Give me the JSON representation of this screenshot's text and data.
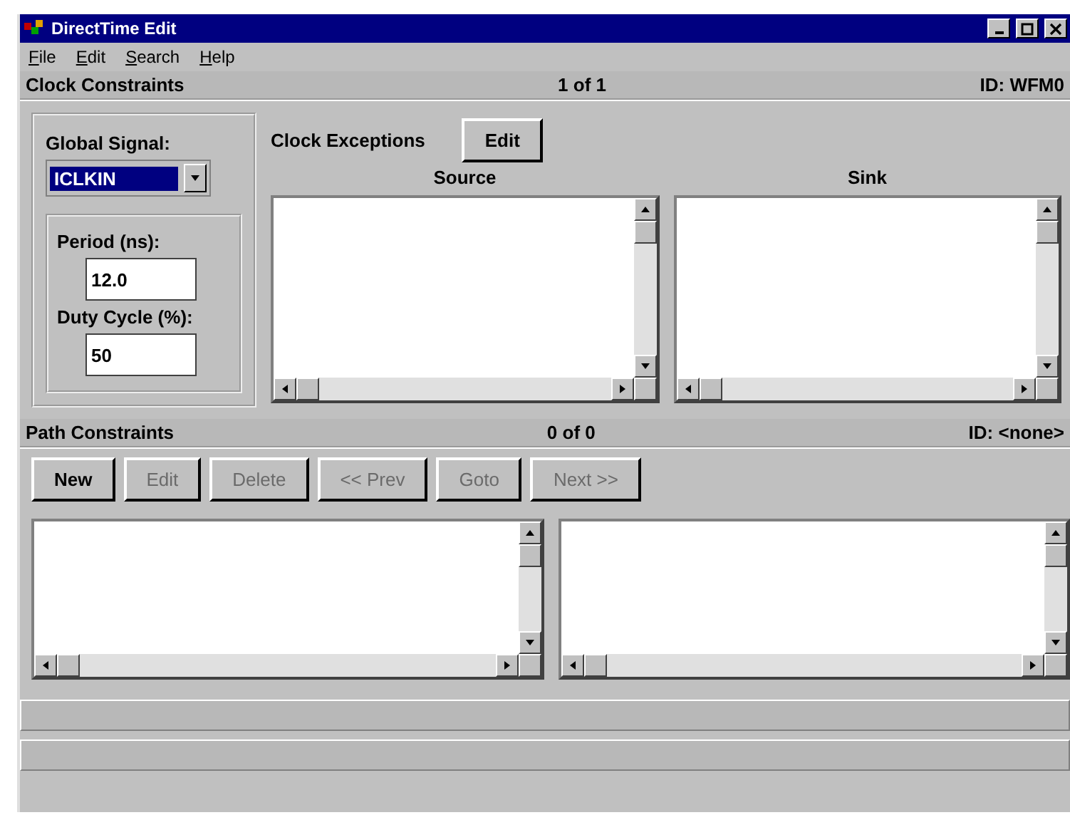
{
  "window": {
    "title": "DirectTime Edit"
  },
  "menu": [
    {
      "label": "File"
    },
    {
      "label": "Edit"
    },
    {
      "label": "Search"
    },
    {
      "label": "Help"
    }
  ],
  "clock_constraints": {
    "title": "Clock Constraints",
    "position": "1 of 1",
    "id": "ID: WFM0",
    "global_signal": {
      "label": "Global Signal:",
      "value": "ICLKIN",
      "highlighted": true
    },
    "period": {
      "label": "Period (ns):",
      "value": "12.0"
    },
    "duty_cycle": {
      "label": "Duty Cycle (%):",
      "value": "50"
    },
    "exceptions": {
      "label": "Clock Exceptions",
      "edit_button": "Edit",
      "lists": [
        {
          "heading": "Source"
        },
        {
          "heading": "Sink"
        }
      ]
    }
  },
  "path_constraints": {
    "title": "Path Constraints",
    "position": "0 of 0",
    "id": "ID: <none>",
    "buttons": [
      {
        "label": "New",
        "disabled": false
      },
      {
        "label": "Edit",
        "disabled": true
      },
      {
        "label": "Delete",
        "disabled": true
      },
      {
        "label": "<< Prev",
        "disabled": true
      },
      {
        "label": "Goto",
        "disabled": true
      },
      {
        "label": "Next >>",
        "disabled": true
      }
    ],
    "lists": [
      {
        "kind": "listbox"
      },
      {
        "kind": "listbox"
      }
    ]
  }
}
